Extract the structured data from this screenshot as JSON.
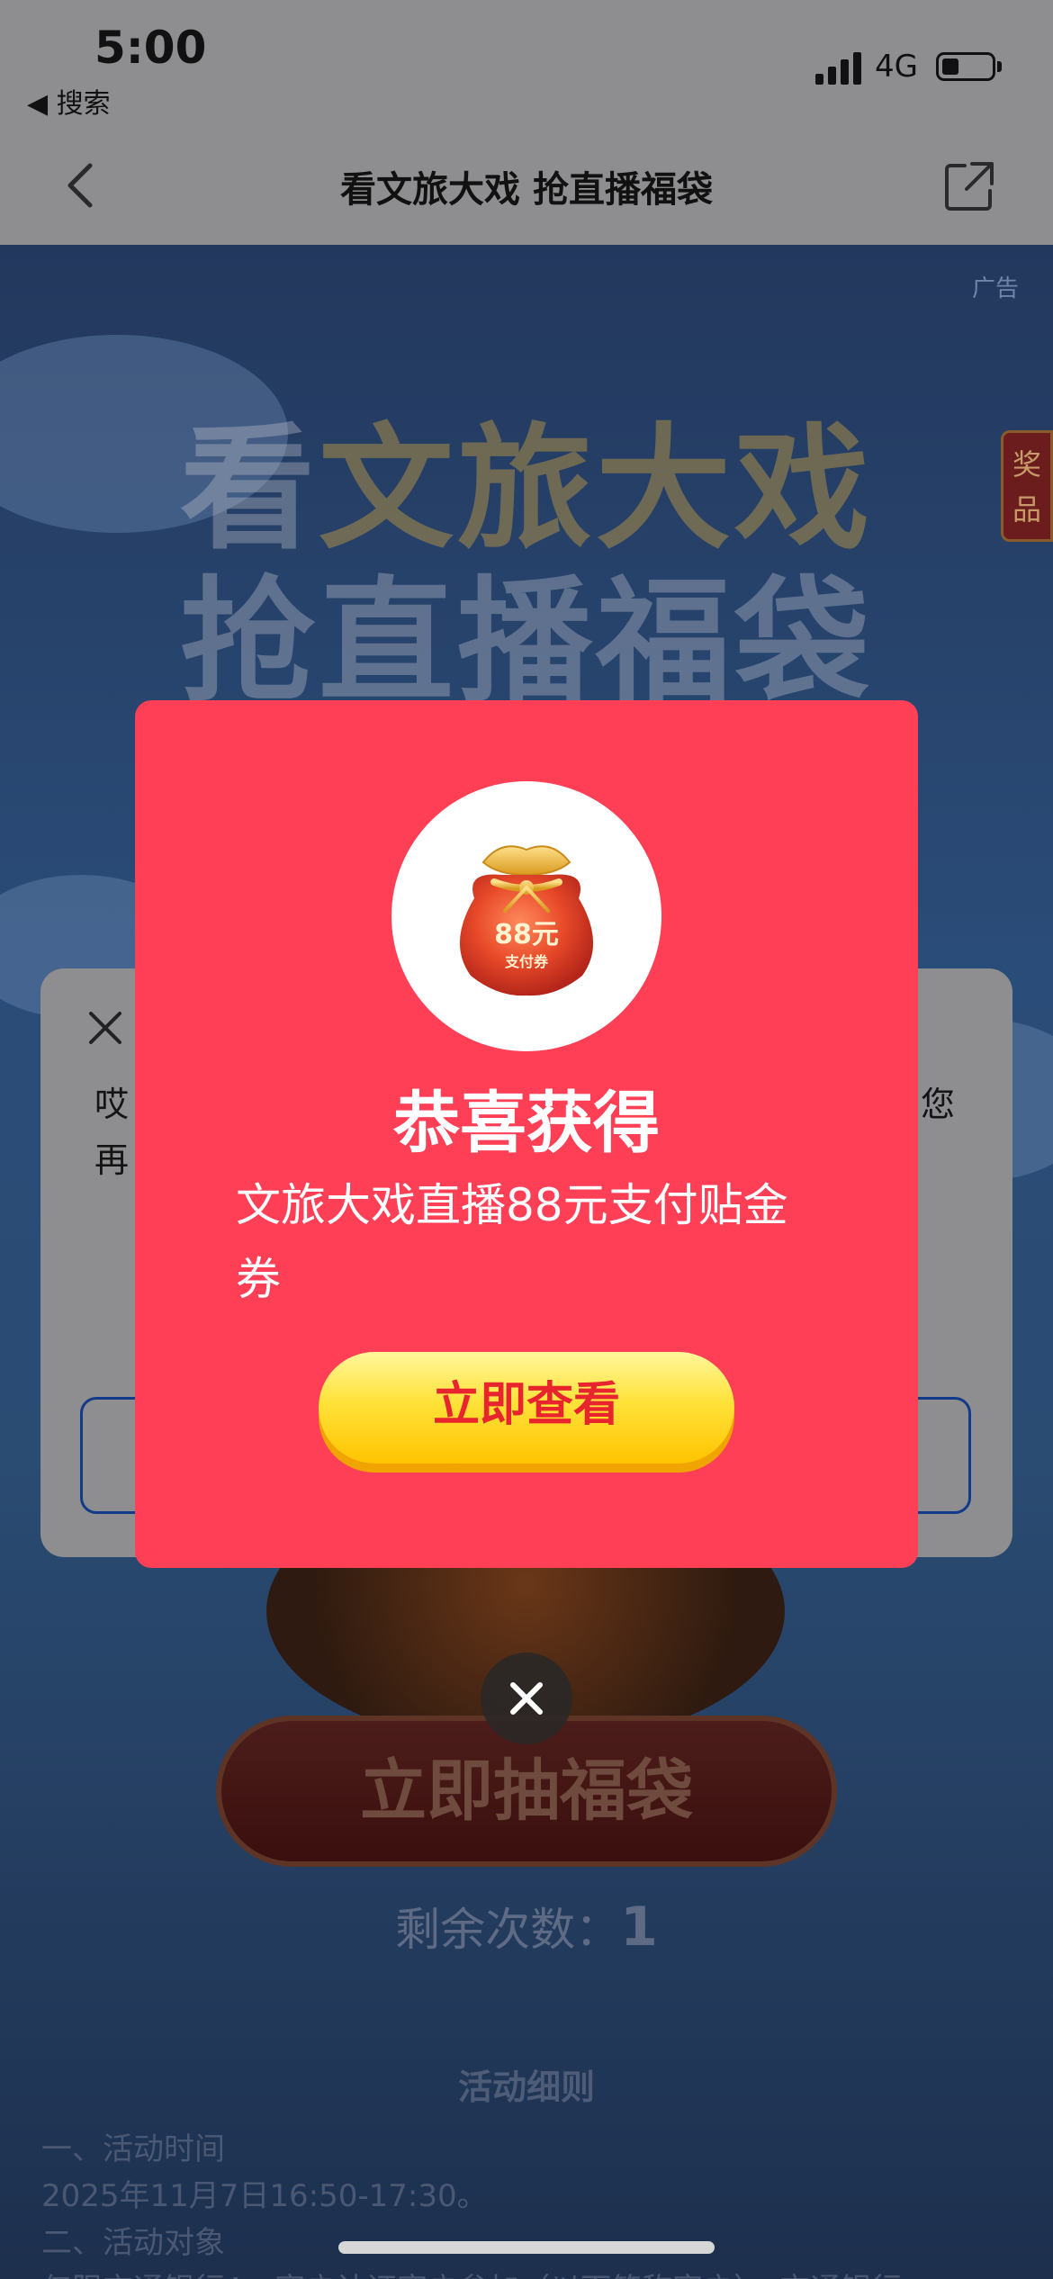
{
  "status_bar": {
    "time": "5:00",
    "back_app": "◀ 搜索",
    "network": "4G"
  },
  "nav": {
    "title": "看文旅大戏 抢直播福袋"
  },
  "background": {
    "ad_tag": "广告",
    "prize_tab": "奖品",
    "hero_line1_a": "看",
    "hero_line1_b": "文旅大戏",
    "hero_line2": "抢直播福袋",
    "draw_button": "立即抽福袋",
    "remaining_label": "剩余次数：",
    "remaining_count": "1",
    "rules_title": "活动细则",
    "rules_lines": [
      "一、活动时间",
      "2025年11月7日16:50-17:30。",
      "二、活动对象",
      "仅限交通银行A...客户认证客户参加（以下简称客户）。交通银行"
    ]
  },
  "under_dialog": {
    "text_left_1": "哎",
    "text_left_2": "再",
    "text_right": "您"
  },
  "popup": {
    "bag_amount": "88元",
    "bag_label": "支付券",
    "title": "恭喜获得",
    "description": "文旅大戏直播88元支付贴金券",
    "view_button": "立即查看"
  },
  "colors": {
    "popup_bg": "#ff3f56",
    "button_yellow": "#ffe23a",
    "button_text": "#e8252e"
  }
}
